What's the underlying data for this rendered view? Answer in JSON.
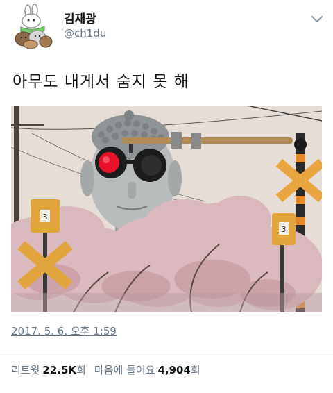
{
  "user": {
    "name": "김재광",
    "handle": "@ch1du"
  },
  "tweet": {
    "text": "아무도 내게서 숨지 못 해",
    "timestamp": "2017. 5. 6. 오후 1:59"
  },
  "stats": {
    "retweets_label": "리트윗",
    "retweets_count": "22.5K",
    "retweets_unit": "회",
    "likes_label": "마음에 들어요",
    "likes_count": "4,904",
    "likes_unit": "회"
  },
  "colors": {
    "text": "#14171a",
    "secondary": "#657786",
    "divider": "#e1e8ed",
    "sky": "#e6ddd6",
    "blossom": "#d9b9bd",
    "signal_red": "#e8132a"
  },
  "icons": {
    "menu": "chevron-down-icon",
    "photo_subjects": [
      "buddha-statue",
      "railroad-crossing-signal",
      "cherry-blossoms"
    ]
  }
}
